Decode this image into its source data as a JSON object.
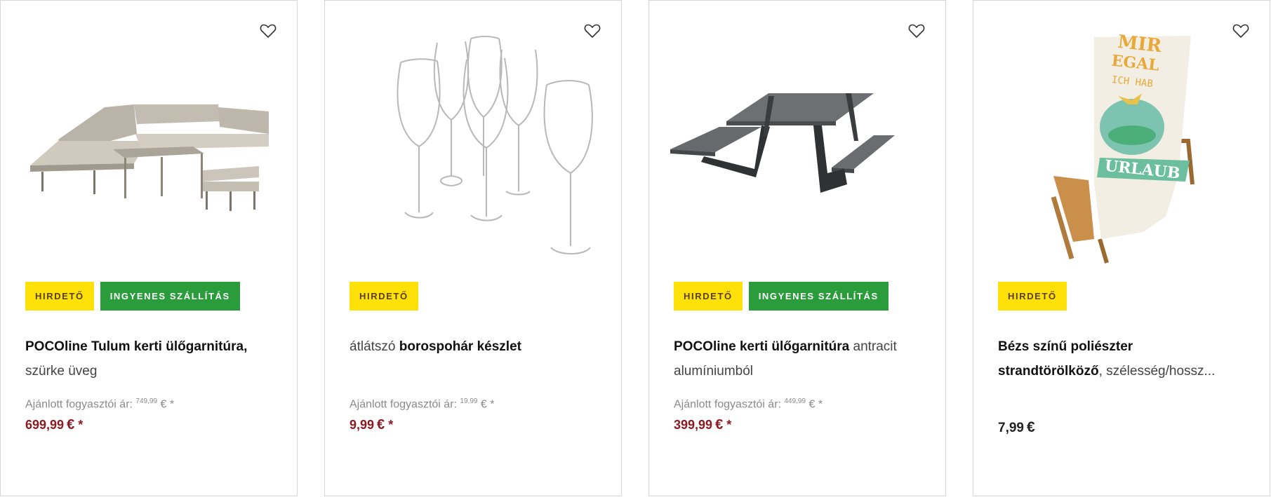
{
  "badges": {
    "ad": "HIRDETŐ",
    "shipping": "INGYENES SZÁLLÍTÁS"
  },
  "rrp_label": "Ajánlott fogyasztói ár:",
  "currency": "€",
  "asterisk": "*",
  "products": [
    {
      "title_bold": "POCOline Tulum kerti ülőgarnitúra,",
      "title_rest": "szürke üveg",
      "rrp_value": "749,99",
      "price": "699,99",
      "free_shipping": true,
      "icon": "outdoor-sofa-set-image"
    },
    {
      "title_prefix": "átlátszó",
      "title_bold": "borospohár készlet",
      "rrp_value": "19,99",
      "price": "9,99",
      "free_shipping": false,
      "icon": "wine-glass-set-image"
    },
    {
      "title_bold": "POCOline kerti ülőgarnitúra",
      "title_rest_1": "antracit",
      "title_rest_2": "alumíniumból",
      "rrp_value": "449,99",
      "price": "399,99",
      "free_shipping": true,
      "icon": "picnic-table-image"
    },
    {
      "title_bold_1": "Bézs színű poliészter",
      "title_bold_2": "strandtörölköző",
      "title_rest": ", szélesség/hossz...",
      "price": "7,99",
      "free_shipping": false,
      "icon": "beach-towel-lounger-image",
      "image_text": [
        "MIR",
        "EGAL",
        "ICH HAB",
        "URLAUB"
      ]
    }
  ],
  "colors": {
    "ad_badge": "#ffe10a",
    "shipping_badge": "#2a9c3b",
    "price": "#8b1a22"
  }
}
